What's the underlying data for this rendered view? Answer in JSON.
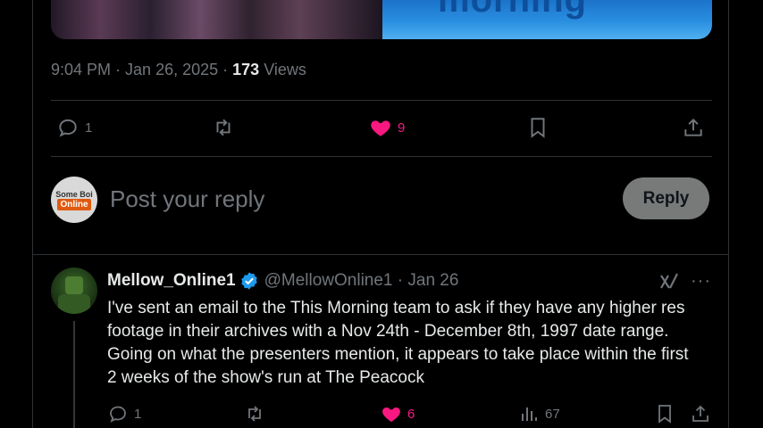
{
  "tweet": {
    "time": "9:04 PM",
    "date": "Jan 26, 2025",
    "views_count": "173",
    "views_label": "Views",
    "media_logo_text": "morning"
  },
  "tweet_actions": {
    "replies": "1",
    "likes": "9"
  },
  "composer": {
    "avatar_line1": "Some Boi",
    "avatar_line2": "Online",
    "placeholder": "Post your reply",
    "reply_button": "Reply"
  },
  "reply": {
    "name": "Mellow_Online1",
    "handle": "@MellowOnline1",
    "date": "Jan 26",
    "text": "I've sent an email to the This Morning team to ask if they have any higher res footage in their archives with a Nov 24th - December 8th, 1997 date range. Going on what the presenters mention, it appears to take place within the first 2 weeks of the show's run at The Peacock",
    "replies": "1",
    "likes": "6",
    "views": "67"
  },
  "colors": {
    "background": "#000000",
    "muted": "#71767b",
    "like_pink": "#f91880",
    "verified_blue": "#1d9bf0"
  }
}
